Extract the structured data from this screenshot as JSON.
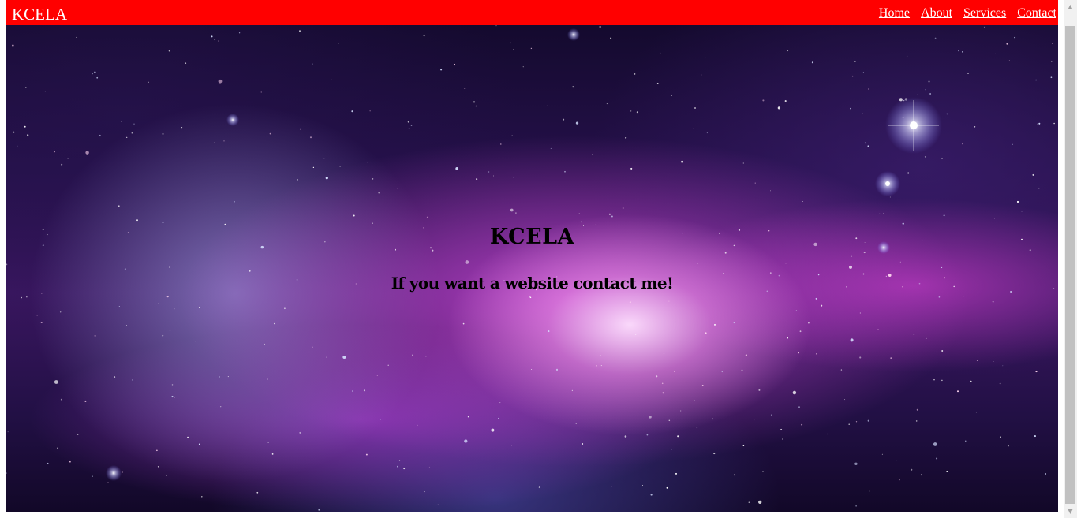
{
  "navbar": {
    "brand": "KCELA",
    "links": [
      {
        "label": "Home"
      },
      {
        "label": "About"
      },
      {
        "label": "Services"
      },
      {
        "label": "Contact"
      }
    ],
    "background_color": "#ff0000",
    "text_color": "#ffffff"
  },
  "hero": {
    "title": "KCELA",
    "subtitle": "If you want a website contact me!",
    "background": "galaxy-nebula-image"
  },
  "scrollbar": {
    "up_icon": "triangle-up-icon",
    "down_icon": "triangle-down-icon"
  }
}
